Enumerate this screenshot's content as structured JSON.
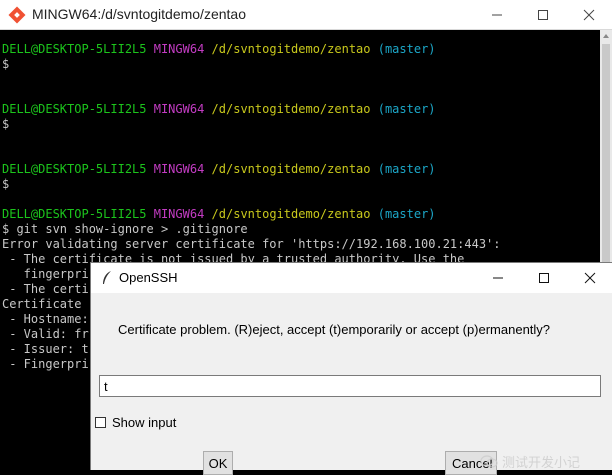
{
  "terminal": {
    "title": "MINGW64:/d/svntogitdemo/zentao",
    "prompt": {
      "user_host": "DELL@DESKTOP-5LII2L5",
      "shell": "MINGW64",
      "path": "/d/svntogitdemo/zentao",
      "branch": "(master)",
      "symbol": "$"
    },
    "command": "$ git svn show-ignore > .gitignore",
    "output": [
      "Error validating server certificate for 'https://192.168.100.21:443':",
      " - The certificate is not issued by a trusted authority. Use the",
      "   fingerpri",
      " - The certi",
      "Certificate",
      " - Hostname:",
      " - Valid: fr",
      " - Issuer: t",
      " - Fingerpri"
    ],
    "colors": {
      "user_host": "#1cc41c",
      "shell": "#c33cc3",
      "path": "#c8c81c",
      "branch": "#1ca7c8"
    }
  },
  "dialog": {
    "title": "OpenSSH",
    "message": "Certificate problem. (R)eject, accept (t)emporarily or accept (p)ermanently?",
    "input_value": "t",
    "checkbox_label": "Show input",
    "ok_label": "OK",
    "cancel_label": "Cancel"
  },
  "watermark": {
    "text": "测试开发小记"
  }
}
